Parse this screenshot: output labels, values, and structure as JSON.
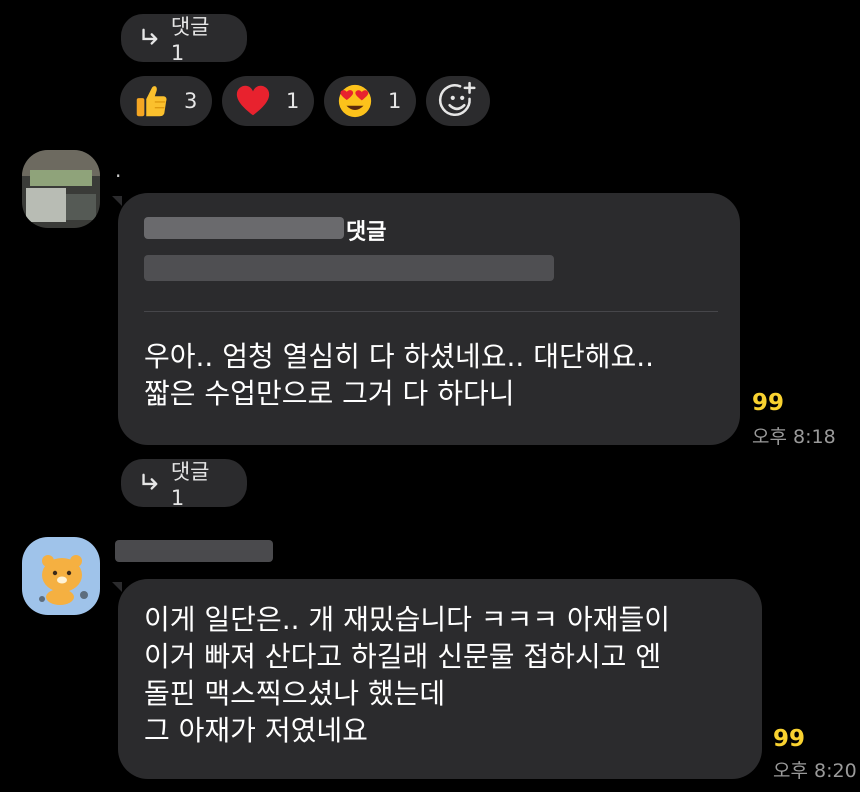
{
  "top_thread": {
    "label": "댓글 1"
  },
  "reactions": [
    {
      "icon": "thumbs-up-icon",
      "count": "3"
    },
    {
      "icon": "heart-icon",
      "count": "1"
    },
    {
      "icon": "heart-eyes-icon",
      "count": "1"
    }
  ],
  "message1": {
    "sender_dot": ".",
    "quote_suffix": "댓글",
    "text": "우아.. 엄청 열심히 다 하셨네요.. 대단해요..\n짧은 수업만으로 그거 다 하다니",
    "unread": "99",
    "time": "오후 8:18",
    "thread_label": "댓글 1"
  },
  "message2": {
    "text": "이게 일단은.. 개 재밌습니다 ㅋㅋㅋ 아재들이\n이거 빠져 산다고 하길래 신문물 접하시고 엔\n돌핀 맥스찍으셨나 했는데\n그 아재가 저였네요",
    "unread": "99",
    "time": "오후 8:20"
  },
  "colors": {
    "background": "#000000",
    "bubble": "#2b2b2d",
    "unread": "#f9d230",
    "time": "#9a9a9a"
  }
}
